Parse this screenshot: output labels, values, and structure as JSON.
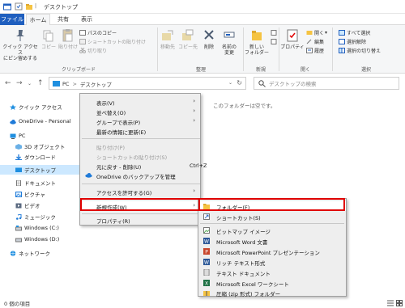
{
  "window": {
    "title": "デスクトップ"
  },
  "tabs": [
    "ファイル",
    "ホーム",
    "共有",
    "表示"
  ],
  "ribbon": {
    "clipboard": {
      "pin_label": "クイック アクセス\nにピン留めする",
      "copy_label": "コピー",
      "paste_label": "貼り付け",
      "copy_path_label": "パスのコピー",
      "paste_shortcut_label": "ショートカットの貼り付け",
      "cut_label": "切り取り",
      "group_label": "クリップボード"
    },
    "organize": {
      "move_label": "移動先",
      "copyto_label": "コピー先",
      "delete_label": "削除",
      "rename_label": "名前の\n変更",
      "group_label": "整理"
    },
    "new": {
      "new_folder_label": "新しい\nフォルダー",
      "group_label": "新規"
    },
    "open": {
      "properties_label": "プロパティ",
      "open_label": "開く",
      "edit_label": "編集",
      "history_label": "履歴",
      "group_label": "開く"
    },
    "select": {
      "select_all_label": "すべて選択",
      "select_none_label": "選択解除",
      "invert_label": "選択の切り替え",
      "group_label": "選択"
    }
  },
  "address": {
    "path_root": "PC",
    "path_sep": ">",
    "path_current": "デスクトップ",
    "search_placeholder": "デスクトップの検索"
  },
  "sidebar": {
    "items": [
      {
        "label": "クイック アクセス"
      },
      {
        "label": "OneDrive - Personal"
      },
      {
        "label": "PC"
      },
      {
        "label": "3D オブジェクト"
      },
      {
        "label": "ダウンロード"
      },
      {
        "label": "デスクトップ"
      },
      {
        "label": "ドキュメント"
      },
      {
        "label": "ピクチャ"
      },
      {
        "label": "ビデオ"
      },
      {
        "label": "ミュージック"
      },
      {
        "label": "Windows (C:)"
      },
      {
        "label": "Windows (D:)"
      },
      {
        "label": "ネットワーク"
      }
    ]
  },
  "main": {
    "empty_message": "このフォルダーは空です。"
  },
  "status": {
    "item_count": "0 個の項目"
  },
  "context_menu": {
    "items": [
      {
        "label": "表示(V)"
      },
      {
        "label": "並べ替え(O)"
      },
      {
        "label": "グループで表示(P)"
      },
      {
        "label": "最新の情報に更新(E)"
      },
      {
        "label": "貼り付け(P)"
      },
      {
        "label": "ショートカットの貼り付け(S)"
      },
      {
        "label": "元に戻す - 削除(U)",
        "shortcut": "Ctrl+Z"
      },
      {
        "label": "OneDrive のバックアップを管理"
      },
      {
        "label": "アクセスを許可する(G)"
      },
      {
        "label": "新規作成(W)"
      },
      {
        "label": "プロパティ(R)"
      }
    ]
  },
  "submenu": {
    "items": [
      {
        "label": "フォルダー(F)"
      },
      {
        "label": "ショートカット(S)"
      },
      {
        "label": "ビットマップ イメージ"
      },
      {
        "label": "Microsoft Word 文書"
      },
      {
        "label": "Microsoft PowerPoint プレゼンテーション"
      },
      {
        "label": "リッチ テキスト形式"
      },
      {
        "label": "テキスト ドキュメント"
      },
      {
        "label": "Microsoft Excel ワークシート"
      },
      {
        "label": "圧縮 (zip 形式) フォルダー"
      }
    ]
  },
  "colors": {
    "accent": "#1f5fbf",
    "highlight_red": "#e00000",
    "selection": "#cce8ff"
  }
}
